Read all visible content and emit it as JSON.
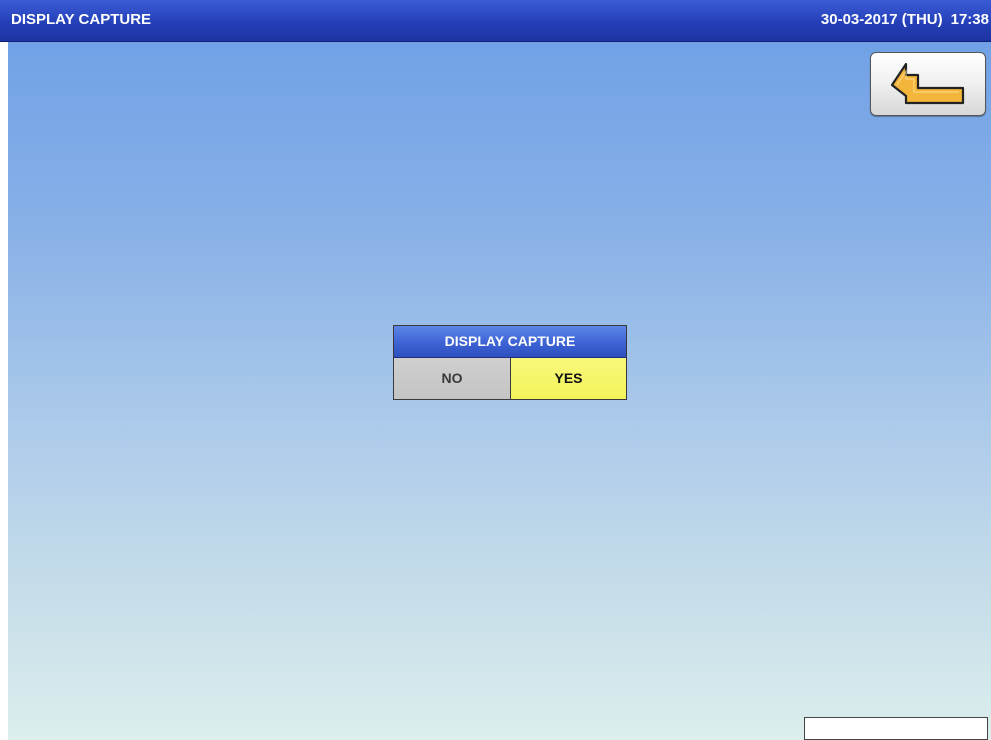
{
  "app": {
    "title": "DISPLAY CAPTURE"
  },
  "header": {
    "date": "30-03-2017 (THU)",
    "time": "17:38"
  },
  "toolbar": {
    "back_icon": "return-arrow-icon"
  },
  "dialog": {
    "title": "DISPLAY CAPTURE",
    "no_label": "NO",
    "yes_label": "YES"
  },
  "status": {
    "text": ""
  },
  "colors": {
    "titlebar": "#2440b8",
    "dialog_title": "#3d63d4",
    "no_button": "#c9c9c9",
    "yes_button": "#f5f56a",
    "back_arrow": "#f2b436"
  }
}
